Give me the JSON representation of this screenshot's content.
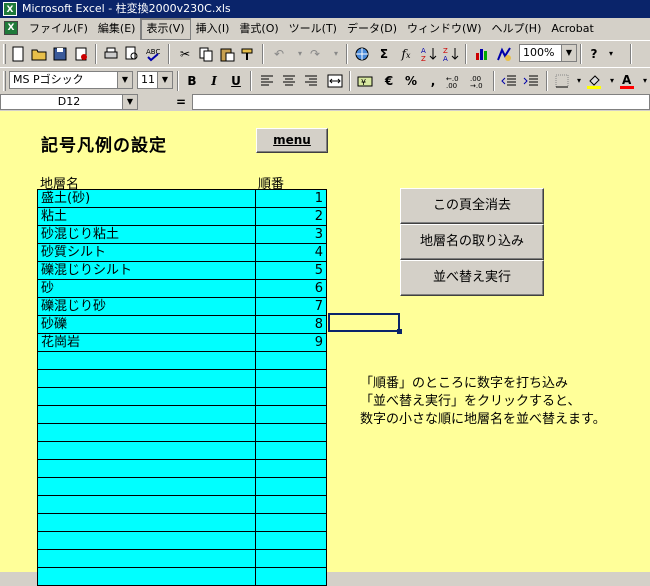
{
  "window": {
    "title": "Microsoft Excel - 柱変換2000v230C.xls",
    "app_icon": "X"
  },
  "menubar": {
    "items": [
      "ファイル(F)",
      "編集(E)",
      "表示(V)",
      "挿入(I)",
      "書式(O)",
      "ツール(T)",
      "データ(D)",
      "ウィンドウ(W)",
      "ヘルプ(H)",
      "Acrobat"
    ],
    "active_index": 2
  },
  "toolbar": {
    "zoom": "100%"
  },
  "format_toolbar": {
    "font_name": "MS Pゴシック",
    "font_size": "11",
    "bold": "B",
    "italic": "I",
    "underline": "U",
    "percent": "%",
    "comma": ",",
    "currency_icon": "yen-currency-icon"
  },
  "formula_bar": {
    "name_box": "D12",
    "equals": "=",
    "formula": ""
  },
  "sheet": {
    "heading": "記号凡例の設定",
    "menu_button": "menu",
    "column_headers": {
      "name": "地層名",
      "order": "順番"
    },
    "rows": [
      {
        "name": "盛土(砂)",
        "order": "1"
      },
      {
        "name": "粘土",
        "order": "2"
      },
      {
        "name": "砂混じり粘土",
        "order": "3"
      },
      {
        "name": "砂質シルト",
        "order": "4"
      },
      {
        "name": "礫混じりシルト",
        "order": "5"
      },
      {
        "name": "砂",
        "order": "6"
      },
      {
        "name": "礫混じり砂",
        "order": "7"
      },
      {
        "name": "砂礫",
        "order": "8"
      },
      {
        "name": "花崗岩",
        "order": "9"
      },
      {
        "name": "",
        "order": ""
      },
      {
        "name": "",
        "order": ""
      },
      {
        "name": "",
        "order": ""
      },
      {
        "name": "",
        "order": ""
      },
      {
        "name": "",
        "order": ""
      },
      {
        "name": "",
        "order": ""
      },
      {
        "name": "",
        "order": ""
      },
      {
        "name": "",
        "order": ""
      },
      {
        "name": "",
        "order": ""
      },
      {
        "name": "",
        "order": ""
      },
      {
        "name": "",
        "order": ""
      },
      {
        "name": "",
        "order": ""
      },
      {
        "name": "",
        "order": ""
      }
    ],
    "buttons": {
      "clear_all": "この頁全消去",
      "import_names": "地層名の取り込み",
      "sort": "並べ替え実行"
    },
    "note": [
      "「順番」のところに数字を打ち込み",
      "「並べ替え実行」をクリックすると、",
      "数字の小さな順に地層名を並べ替えます。"
    ]
  },
  "colors": {
    "sheet_bg": "#ffff99",
    "table_fill": "#00ffff",
    "titlebar": "#0a246a"
  }
}
